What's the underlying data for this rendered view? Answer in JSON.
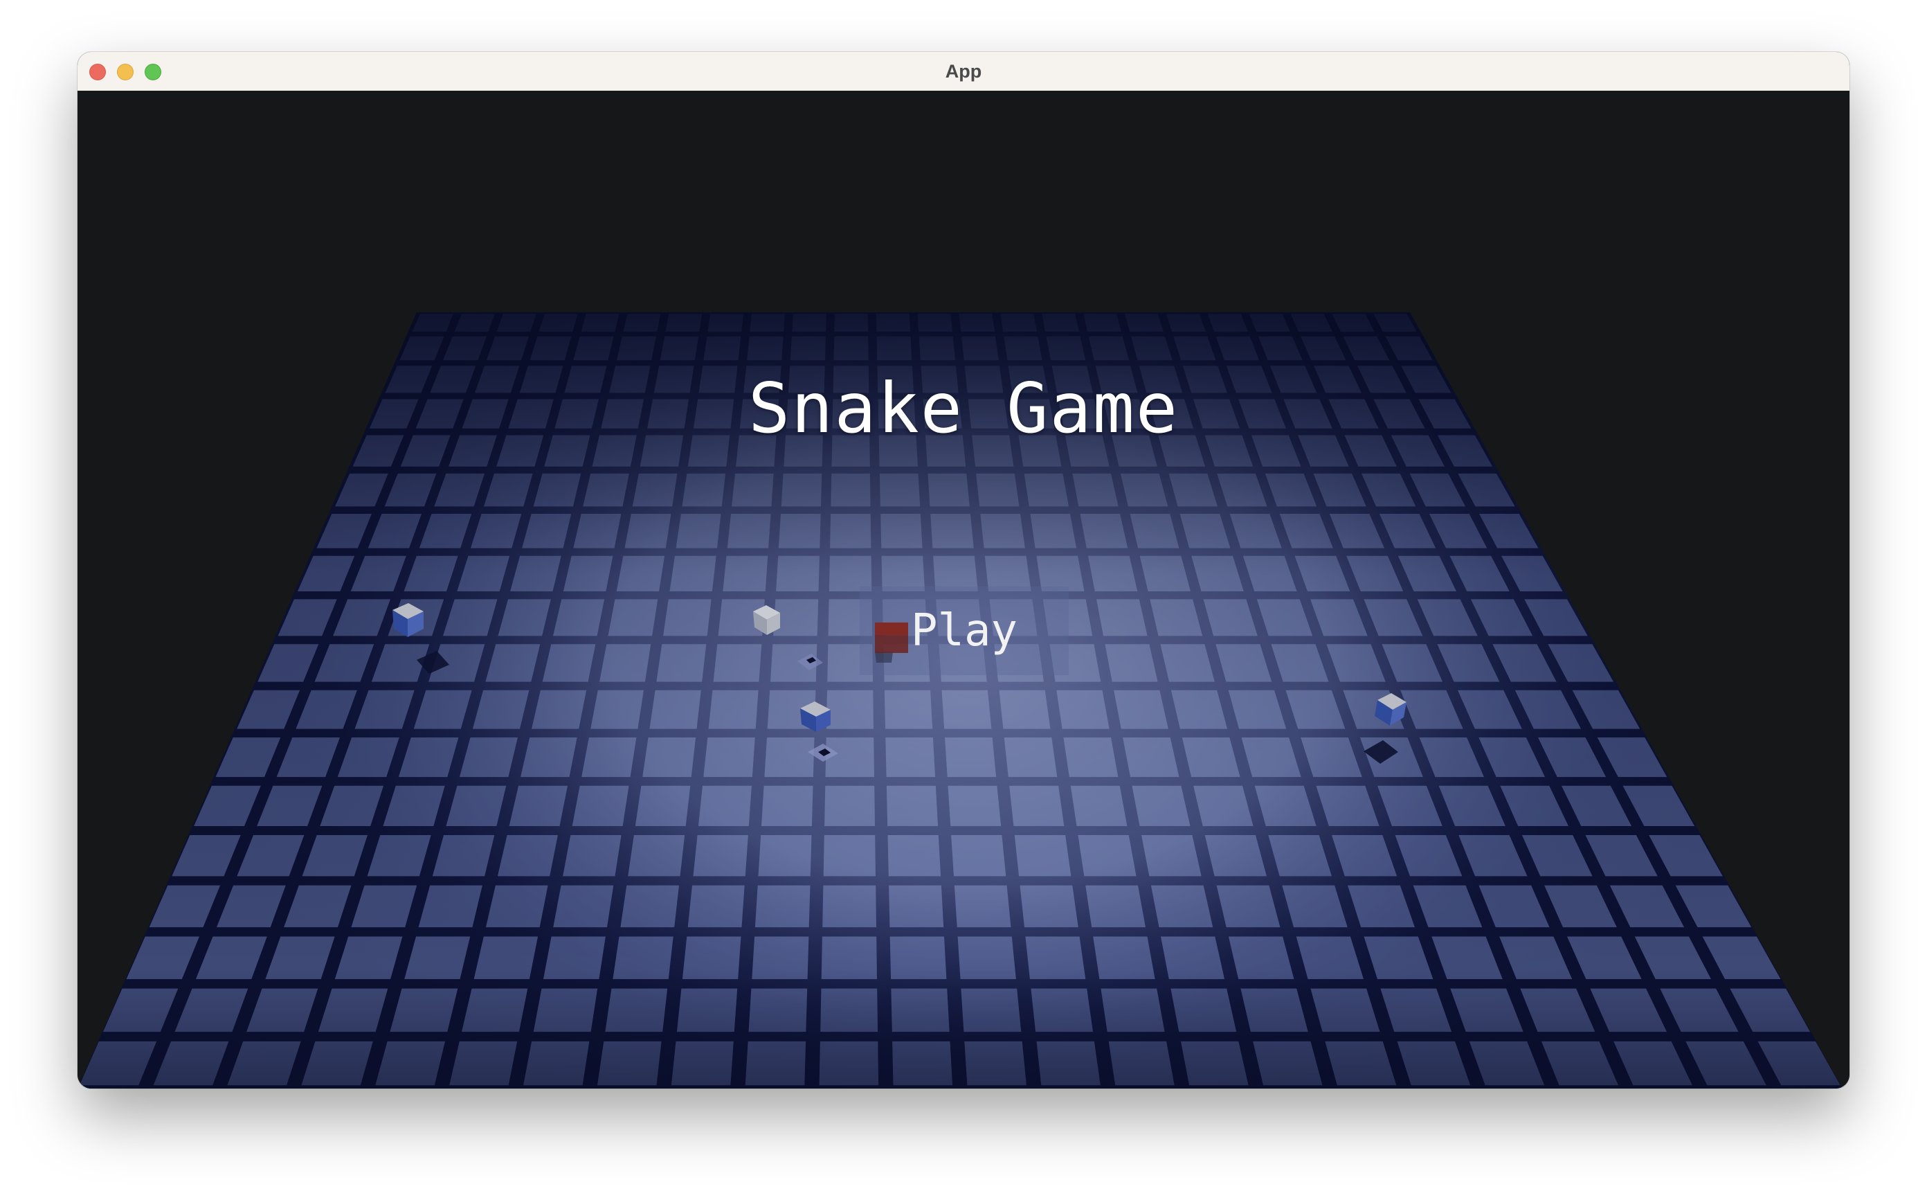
{
  "window": {
    "title": "App"
  },
  "game": {
    "title": "Snake Game",
    "play_label": "Play"
  },
  "icons": {
    "close": "close-dot-icon",
    "minimize": "minimize-dot-icon",
    "maximize": "maximize-dot-icon"
  },
  "colors": {
    "board_tile": "#6a78b0",
    "board_edge": "#0b1030",
    "background": "#161718",
    "obstacle_top": "#b9bcc4",
    "obstacle_side": "#2f4a9a",
    "snake_head": "#8b2a22",
    "title_text": "#ffffff"
  }
}
